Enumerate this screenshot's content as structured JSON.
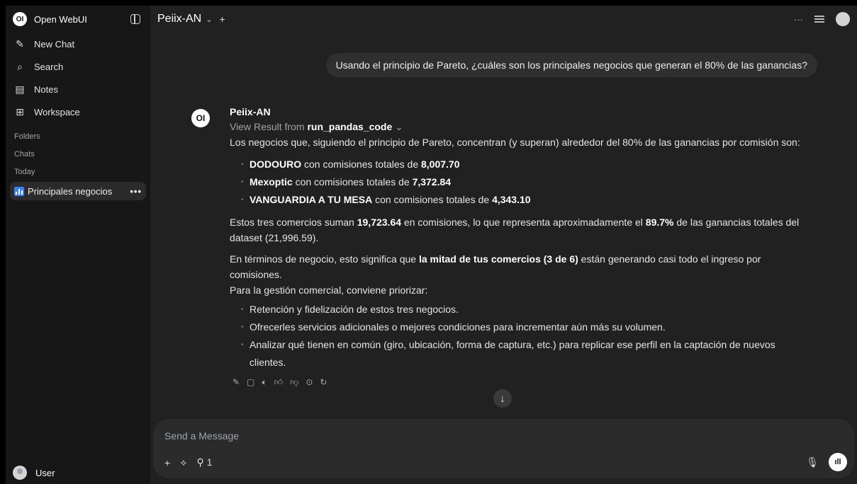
{
  "sidebar": {
    "app_name": "Open WebUI",
    "logo_text": "OI",
    "items": [
      {
        "label": "New Chat",
        "icon": "✎"
      },
      {
        "label": "Search",
        "icon": "⌕"
      },
      {
        "label": "Notes",
        "icon": "▤"
      },
      {
        "label": "Workspace",
        "icon": "⊞"
      }
    ],
    "sections": {
      "folders": "Folders",
      "chats": "Chats",
      "today": "Today"
    },
    "active_chat": {
      "title": "Principales negocios",
      "menu": "•••"
    },
    "user_name": "User"
  },
  "header": {
    "model": "Peiix-AN",
    "chevron": "⌄",
    "plus": "+",
    "more": "···"
  },
  "conversation": {
    "user_message": "Usando el principio de Pareto, ¿cuáles son los principales negocios que generan el 80% de las ganancias?",
    "assistant": {
      "logo_text": "OI",
      "name": "Peiix-AN",
      "view_result_prefix": "View Result from ",
      "tool_name": "run_pandas_code",
      "intro": "Los negocios que, siguiendo el principio de Pareto, concentran (y superan) alrededor del 80% de las ganancias por comisión son:",
      "top_list": [
        {
          "name": "DODOURO",
          "text": " con comisiones totales de ",
          "value": "8,007.70"
        },
        {
          "name": "Mexoptic",
          "text": " con comisiones totales de ",
          "value": "7,372.84"
        },
        {
          "name": "VANGUARDIA A TU MESA",
          "text": " con comisiones totales de ",
          "value": "4,343.10"
        }
      ],
      "summary_a": "Estos tres comercios suman ",
      "summary_total": "19,723.64",
      "summary_b": " en comisiones, lo que representa aproximadamente el ",
      "summary_pct": "89.7%",
      "summary_c": " de las ganancias totales del dataset (21,996.59).",
      "business_a": "En términos de negocio, esto significa que ",
      "business_bold": "la mitad de tus comercios (3 de 6)",
      "business_b": " están generando casi todo el ingreso por comisiones.",
      "priority_intro": "Para la gestión comercial, conviene priorizar:",
      "priorities": [
        "Retención y fidelización de estos tres negocios.",
        "Ofrecerles servicios adicionales o mejores condiciones para incrementar aún más su volumen.",
        "Analizar qué tienen en común (giro, ubicación, forma de captura, etc.) para replicar ese perfil en la captación de nuevos clientes."
      ]
    }
  },
  "composer": {
    "placeholder": "Send a Message",
    "tool_count": "1"
  },
  "icons": [
    "edit-icon",
    "copy-icon",
    "speaker-icon",
    "thumbs-up-icon",
    "thumbs-down-icon",
    "play-icon",
    "regenerate-icon"
  ]
}
